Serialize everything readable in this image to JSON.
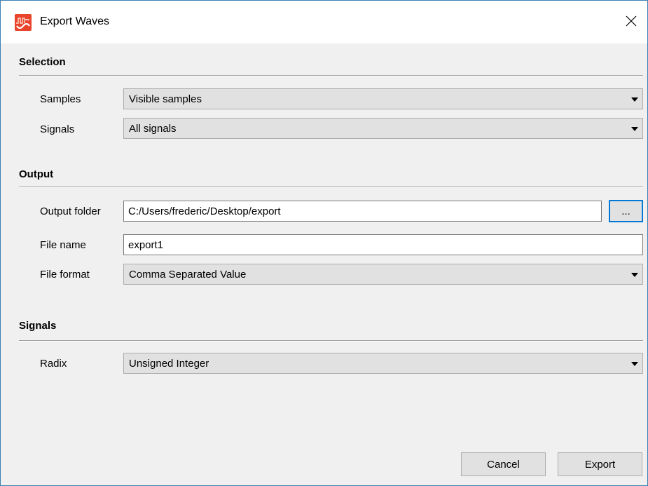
{
  "window": {
    "title": "Export Waves",
    "close_icon": "close-icon",
    "app_icon": "waveform-icon"
  },
  "selection": {
    "heading": "Selection",
    "samples_label": "Samples",
    "samples_value": "Visible samples",
    "signals_label": "Signals",
    "signals_value": "All signals"
  },
  "output": {
    "heading": "Output",
    "folder_label": "Output folder",
    "folder_value": "C:/Users/frederic/Desktop/export",
    "browse_label": "...",
    "filename_label": "File name",
    "filename_value": "export1",
    "format_label": "File format",
    "format_value": "Comma Separated Value"
  },
  "signals": {
    "heading": "Signals",
    "radix_label": "Radix",
    "radix_value": "Unsigned Integer"
  },
  "buttons": {
    "cancel": "Cancel",
    "export": "Export"
  },
  "colors": {
    "accent": "#0078d7",
    "icon_red": "#e8452c",
    "window_border": "#3c7fb1"
  }
}
